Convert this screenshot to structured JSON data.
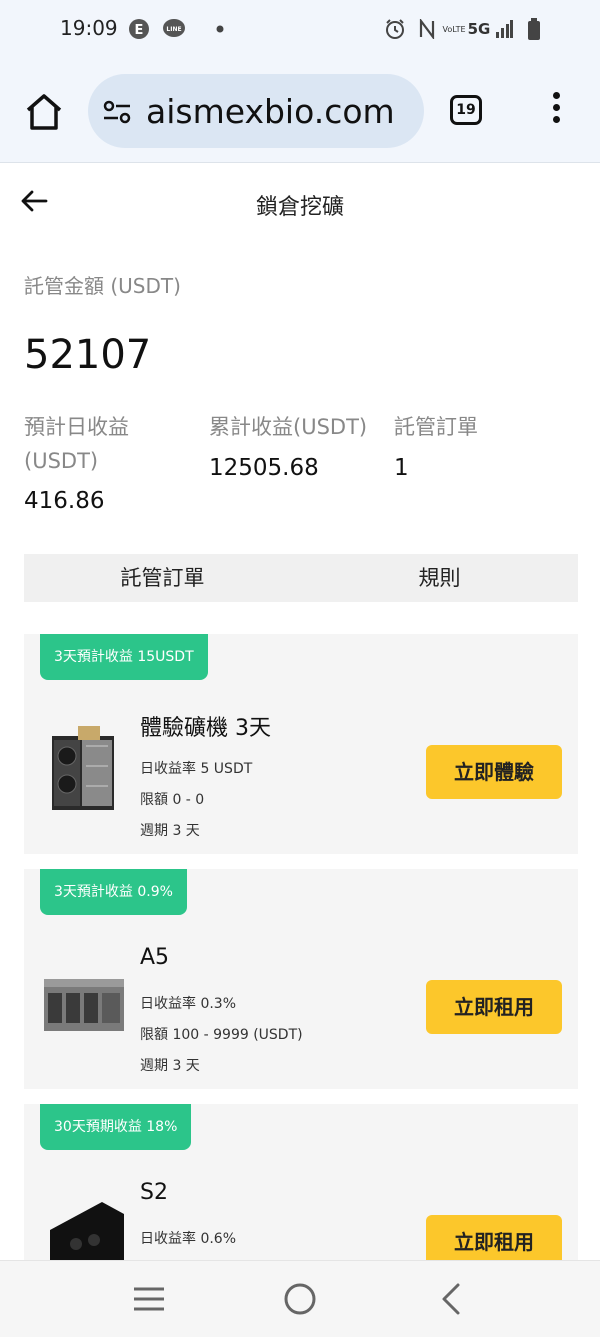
{
  "status_bar": {
    "time": "19:09",
    "icons": [
      "e-icon",
      "line-icon",
      "dot-icon",
      "alarm-icon",
      "nfc-icon",
      "volte-icon",
      "5g-icon",
      "signal-icon",
      "battery-icon"
    ],
    "network": "5G",
    "volte": "VoLTE"
  },
  "browser": {
    "url": "aismexbio.com",
    "tab_count": "19"
  },
  "header": {
    "title": "鎖倉挖礦"
  },
  "summary": {
    "amount_label": "託管金額 (USDT)",
    "amount_value": "52107",
    "daily_label_1": "預計日收益",
    "daily_label_2": "(USDT)",
    "daily_value": "416.86",
    "total_label": "累計收益(USDT)",
    "total_value": "12505.68",
    "orders_label": "託管訂單",
    "orders_value": "1"
  },
  "tabs": [
    "託管訂單",
    "規則"
  ],
  "products": [
    {
      "badge": "3天預計收益 15USDT",
      "name": "體驗礦機 3天",
      "rate": "日收益率 5 USDT",
      "limit": "限額 0 - 0",
      "period": "週期 3 天",
      "button": "立即體驗"
    },
    {
      "badge": "3天預計收益 0.9%",
      "name": "A5",
      "rate": "日收益率 0.3%",
      "limit": "限額 100 - 9999 (USDT)",
      "period": "週期 3 天",
      "button": "立即租用"
    },
    {
      "badge": "30天預期收益 18%",
      "name": "S2",
      "rate": "日收益率 0.6%",
      "limit": "",
      "period": "",
      "button": "立即租用"
    }
  ],
  "colors": {
    "badge_green": "#2cc58a",
    "button_yellow": "#fcc72b",
    "browser_bg": "#f2f6fc",
    "url_pill": "#dbe6f3"
  }
}
